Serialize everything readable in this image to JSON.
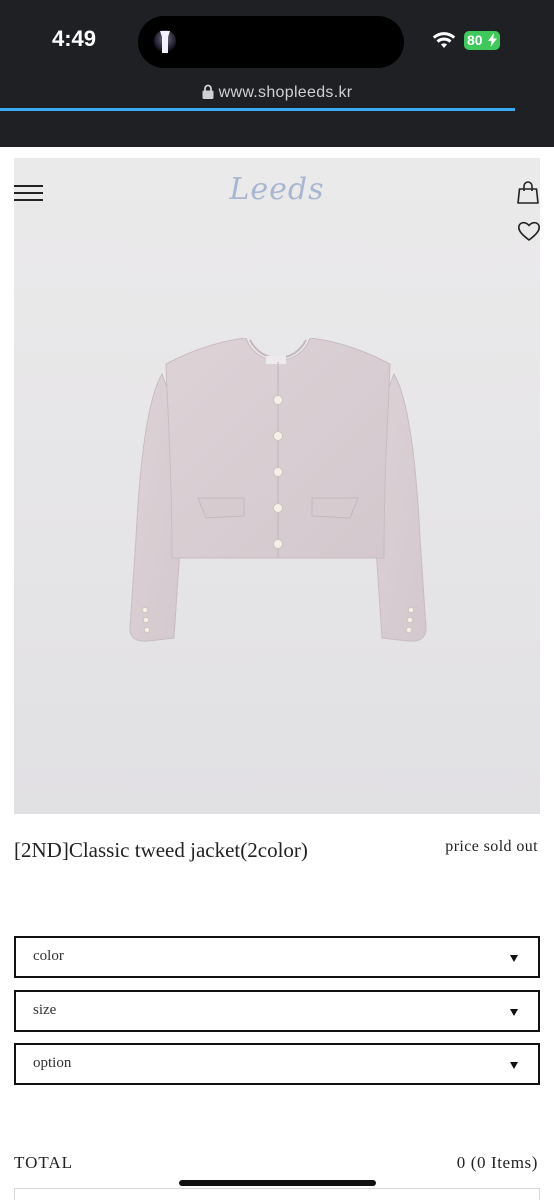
{
  "status_bar": {
    "time": "4:49",
    "battery": "80",
    "battery_color": "#3ec95a"
  },
  "browser": {
    "url": "www.shopleeds.kr",
    "load_progress": 0.93,
    "progress_color": "#3aa9f0"
  },
  "header": {
    "logo": "Leeds",
    "menu_icon": "hamburger-icon",
    "bag_icon": "shopping-bag-icon",
    "wishlist_icon": "heart-icon"
  },
  "product": {
    "name": "[2ND]Classic tweed jacket(2color)",
    "price": "price sold out",
    "image_alt": "pink tweed cropped jacket"
  },
  "options": [
    {
      "label": "color"
    },
    {
      "label": "size"
    },
    {
      "label": "option"
    }
  ],
  "total": {
    "label": "TOTAL",
    "value": "0 (0 Items)"
  },
  "colors": {
    "chrome": "#1f2024",
    "logo": "#a9b6cf",
    "hero_bg": "#e7e6e8",
    "jacket": "#d9cfd3"
  }
}
